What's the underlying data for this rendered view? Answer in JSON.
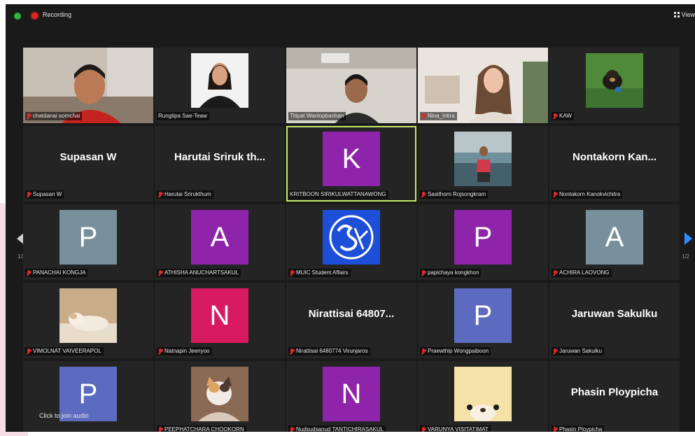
{
  "topbar": {
    "recording_label": "Recording",
    "view_label": "View"
  },
  "pagination": {
    "left": "1/2",
    "right": "1/2"
  },
  "join_audio": "Click to join audio",
  "colors": {
    "active_border": "#c6e86a",
    "muted_mic": "#e02828",
    "next_arrow": "#2d8cff"
  },
  "participants": [
    {
      "name": "chatdanai sornchai",
      "type": "video"
    },
    {
      "name": "Rungtipa Sae-Teaw",
      "type": "video"
    },
    {
      "name": "Titipat Wanlopbanhan",
      "type": "video"
    },
    {
      "name": "Nina_Intira",
      "type": "video"
    },
    {
      "name": "KAW",
      "type": "photo"
    },
    {
      "name": "Supasan W",
      "display": "Supasan W",
      "type": "text"
    },
    {
      "name": "Harutai Srirukthum",
      "display": "Harutai  Sriruk th...",
      "type": "text"
    },
    {
      "name": "KRITBOON SIRIKULWATTANAWONG",
      "letter": "K",
      "avatar_color": "#8e24aa",
      "type": "letter",
      "active": true
    },
    {
      "name": "Sasithorn Rojsongkram",
      "type": "photo"
    },
    {
      "name": "Nontakorn Kanokvichitra",
      "display": "Nontakorn Kan...",
      "type": "text"
    },
    {
      "name": "PANACHAI KONGJA",
      "letter": "P",
      "avatar_color": "#78909c",
      "type": "letter"
    },
    {
      "name": "ATHISHA ANUCHARTSAKUL",
      "letter": "A",
      "avatar_color": "#8e24aa",
      "type": "letter"
    },
    {
      "name": "MUIC Student Affairs",
      "type": "logo"
    },
    {
      "name": "papichaya kongkhon",
      "letter": "P",
      "avatar_color": "#8e24aa",
      "type": "letter"
    },
    {
      "name": "ACHIRA LAOVONG",
      "letter": "A",
      "avatar_color": "#78909c",
      "type": "letter"
    },
    {
      "name": "VIMOLNAT VAIVEERAPOL",
      "type": "photo"
    },
    {
      "name": "Natnapin Jeenyoo",
      "letter": "N",
      "avatar_color": "#d81b60",
      "type": "letter"
    },
    {
      "name": "Nirattisai 6480774 Virunjaros",
      "display": "Nirattisai  64807...",
      "type": "text"
    },
    {
      "name": "Praewthip Wongpaiboon",
      "letter": "P",
      "avatar_color": "#5c6bc0",
      "type": "letter"
    },
    {
      "name": "Jaruwan Sakulku",
      "display": "Jaruwan Sakulku",
      "type": "text"
    },
    {
      "name": "",
      "letter": "P",
      "avatar_color": "#5c6bc0",
      "type": "letter"
    },
    {
      "name": "PEEPHATCHARA CHOOKORN",
      "type": "photo"
    },
    {
      "name": "Nudsudsanud TANTICHIRASAKUL",
      "letter": "N",
      "avatar_color": "#8e24aa",
      "type": "letter"
    },
    {
      "name": "VARUNYA VISITATIMAT",
      "type": "photo"
    },
    {
      "name": "Phasin Ploypicha",
      "display": "Phasin Ploypicha",
      "type": "text"
    }
  ]
}
